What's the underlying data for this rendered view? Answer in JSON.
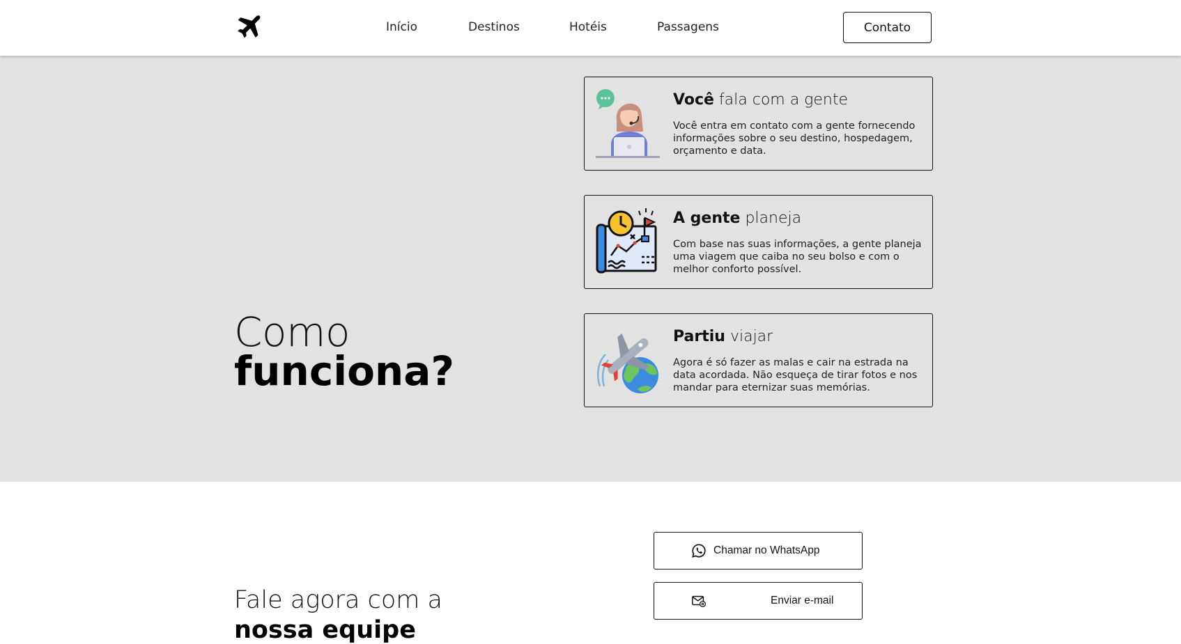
{
  "header": {
    "logo_icon": "airplane-icon",
    "nav": [
      {
        "label": "Início"
      },
      {
        "label": "Destinos"
      },
      {
        "label": "Hotéis"
      },
      {
        "label": "Passagens"
      }
    ],
    "contact_label": "Contato"
  },
  "how": {
    "title_light": "Como",
    "title_bold": "funciona?",
    "background": "#e2e2e2",
    "cards": [
      {
        "icon": "support-agent-icon",
        "title_bold": "Você",
        "title_rest": "fala com a gente",
        "text": "Você entra em contato com a gente fornecendo informações sobre o seu destino, hospedagem, orçamento e data."
      },
      {
        "icon": "travel-plan-map-icon",
        "title_bold": "A gente",
        "title_rest": "planeja",
        "text": "Com base nas suas informações, a gente planeja uma viagem que caiba no seu bolso e com o melhor conforto possível."
      },
      {
        "icon": "plane-globe-icon",
        "title_bold": "Partiu",
        "title_rest": "viajar",
        "text": "Agora é só fazer as malas e cair na estrada na data acordada. Não esqueça de tirar fotos e nos mandar para eternizar suas memórias."
      }
    ]
  },
  "contact": {
    "heading_light": "Fale agora com a",
    "heading_bold": "nossa equipe",
    "whatsapp_label": "Chamar no WhatsApp",
    "whatsapp_icon": "whatsapp-icon",
    "email_label": "Enviar e-mail",
    "email_icon": "email-icon"
  }
}
